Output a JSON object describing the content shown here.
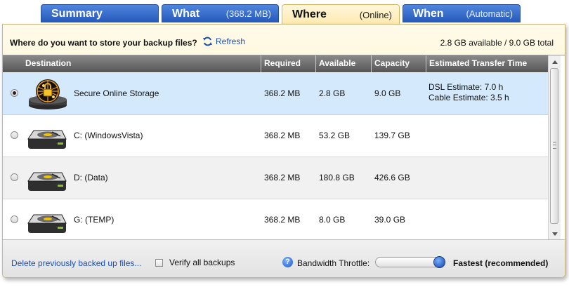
{
  "tabs": [
    {
      "label": "Summary",
      "sub": ""
    },
    {
      "label": "What",
      "sub": "(368.2 MB)"
    },
    {
      "label": "Where",
      "sub": "(Online)"
    },
    {
      "label": "When",
      "sub": "(Automatic)"
    }
  ],
  "header": {
    "question": "Where do you want to store your backup files?",
    "refresh_label": "Refresh",
    "storage_summary": "2.8 GB available / 9.0 GB total"
  },
  "table": {
    "columns": [
      "Destination",
      "Required",
      "Available",
      "Capacity",
      "Estimated Transfer Time"
    ],
    "rows": [
      {
        "name": "Secure Online Storage",
        "required": "368.2 MB",
        "available": "2.8 GB",
        "capacity": "9.0 GB",
        "estimate_dsl": "DSL Estimate: 7.0 h",
        "estimate_cable": "Cable Estimate: 3.5 h",
        "selected": true,
        "icon": "online-storage-icon"
      },
      {
        "name": "C: (WindowsVista)",
        "required": "368.2 MB",
        "available": "53.2 GB",
        "capacity": "139.7 GB",
        "estimate_dsl": "",
        "estimate_cable": "",
        "selected": false,
        "icon": "hard-drive-icon"
      },
      {
        "name": "D: (Data)",
        "required": "368.2 MB",
        "available": "180.8 GB",
        "capacity": "426.6 GB",
        "estimate_dsl": "",
        "estimate_cable": "",
        "selected": false,
        "icon": "hard-drive-icon"
      },
      {
        "name": "G: (TEMP)",
        "required": "368.2 MB",
        "available": "8.0 GB",
        "capacity": "39.0 GB",
        "estimate_dsl": "",
        "estimate_cable": "",
        "selected": false,
        "icon": "hard-drive-icon"
      }
    ]
  },
  "footer": {
    "delete_link": "Delete previously backed up files...",
    "verify_label": "Verify all backups",
    "verify_checked": false,
    "bandwidth_label": "Bandwidth Throttle:",
    "bandwidth_value": "Fastest (recommended)",
    "bandwidth_level": 1.0,
    "help_glyph": "?"
  },
  "colors": {
    "tab_blue": "#2f62c4",
    "tab_active": "#ffeeb8",
    "link_blue": "#1a4fb4",
    "selected_row": "#d4e9fb"
  }
}
